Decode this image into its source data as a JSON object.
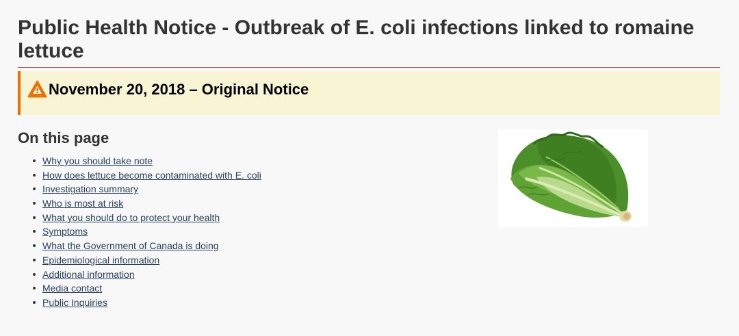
{
  "page": {
    "title": "Public Health Notice - Outbreak of E. coli infections linked to romaine lettuce"
  },
  "notice": {
    "heading": "November 20, 2018 – Original Notice",
    "icon": "warning-triangle-icon",
    "accent_color": "#ee7100",
    "background_color": "#f9f4d4"
  },
  "toc": {
    "heading": "On this page",
    "items": [
      {
        "label": "Why you should take note"
      },
      {
        "label": "How does lettuce become contaminated with E. coli"
      },
      {
        "label": "Investigation summary"
      },
      {
        "label": "Who is most at risk"
      },
      {
        "label": "What you should do to protect your health"
      },
      {
        "label": "Symptoms"
      },
      {
        "label": "What the Government of Canada is doing"
      },
      {
        "label": "Epidemiological information"
      },
      {
        "label": "Additional information"
      },
      {
        "label": "Media contact"
      },
      {
        "label": "Public Inquiries"
      }
    ]
  },
  "colors": {
    "link": "#284162",
    "title_rule": "#b8463f",
    "text": "#333333"
  },
  "image": {
    "subject": "romaine-lettuce-image"
  }
}
